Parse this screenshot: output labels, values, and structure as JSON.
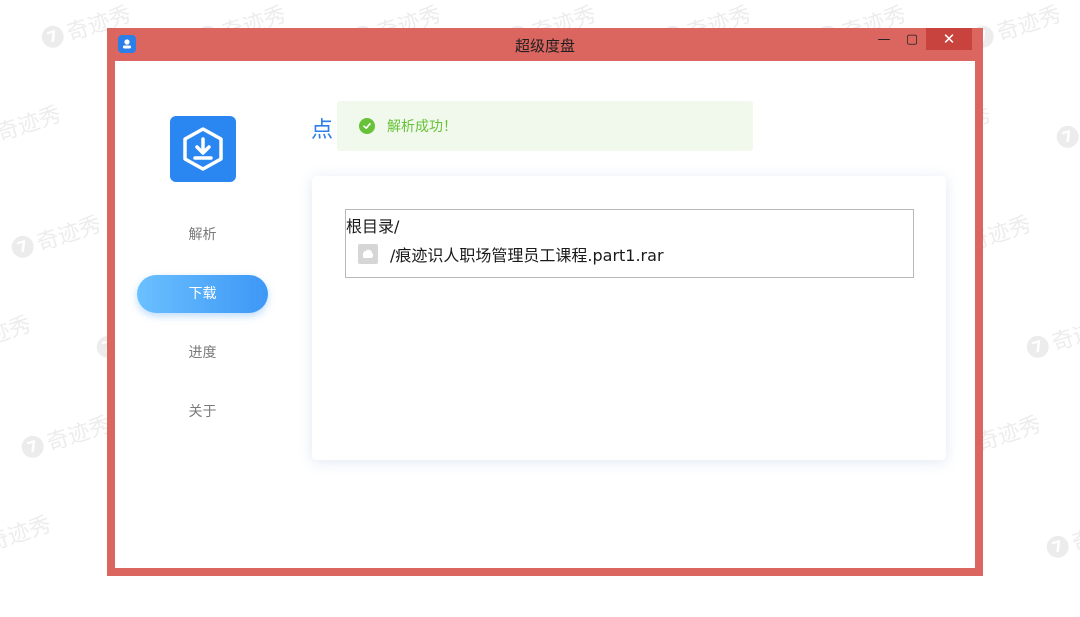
{
  "watermark": {
    "text": "奇迹秀",
    "logo": "7"
  },
  "window": {
    "title": "超级度盘",
    "minimize_glyph": "—",
    "maximize_glyph": "▢",
    "close_glyph": "✕"
  },
  "sidebar": {
    "items": [
      {
        "label": "解析"
      },
      {
        "label": "下载"
      },
      {
        "label": "进度"
      },
      {
        "label": "关于"
      }
    ],
    "active_index": 1
  },
  "main": {
    "heading": "点",
    "toast": {
      "text": "解析成功！"
    },
    "tree": {
      "root": "根目录/",
      "files": [
        {
          "name": "/痕迹识人职场管理员工课程.part1.rar"
        }
      ]
    }
  },
  "colors": {
    "window_frame": "#db6660",
    "accent": "#2c7fe8",
    "success": "#67c23a",
    "success_bg": "#f0f9eb"
  },
  "icons": [
    "app-icon",
    "download-icon",
    "check-circle-icon",
    "file-icon"
  ]
}
